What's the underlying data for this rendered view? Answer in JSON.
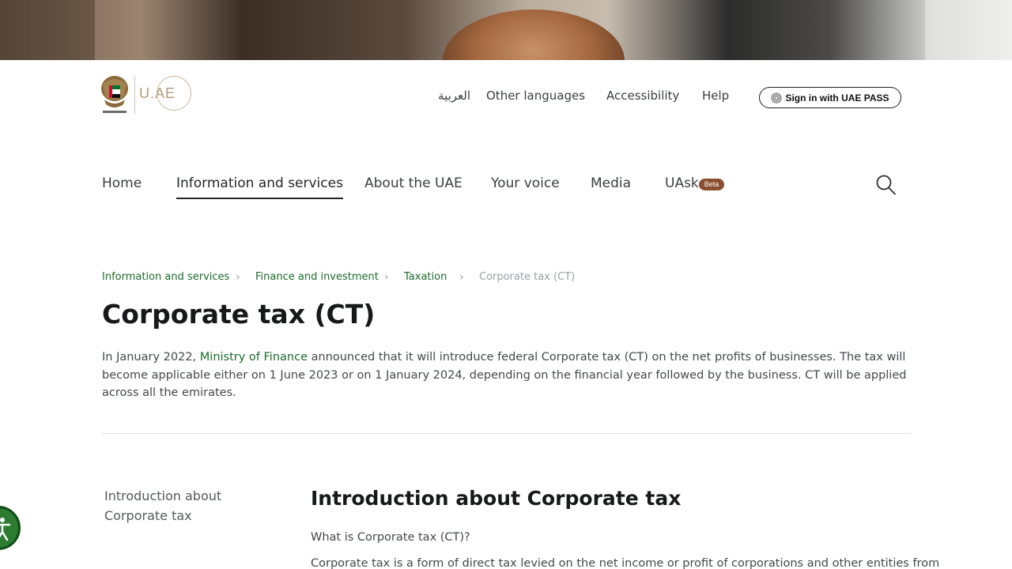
{
  "header": {
    "logo_text": "U.AE",
    "links": {
      "arabic": "العربية",
      "other_languages": "Other languages",
      "accessibility": "Accessibility",
      "help": "Help"
    },
    "sign_in_label": "Sign in with UAE PASS"
  },
  "nav": {
    "items": [
      "Home",
      "Information and services",
      "About the UAE",
      "Your voice",
      "Media",
      "UAsk"
    ],
    "active": "Information and services",
    "beta_label": "Beta"
  },
  "breadcrumb": [
    "Information and services",
    "Finance and investment",
    "Taxation",
    "Corporate tax (CT)"
  ],
  "page": {
    "title": "Corporate tax (CT)",
    "intro_before_link": "In January 2022, ",
    "intro_link": "Ministry of Finance",
    "intro_after_link": " announced that it will introduce federal Corporate tax (CT) on the net profits of businesses. The tax will become applicable either on 1 June 2023 or on 1 January 2024, depending on the financial year followed by the business. CT will be applied across all the emirates."
  },
  "side_nav": {
    "item": "Introduction about Corporate tax"
  },
  "section": {
    "heading": "Introduction about Corporate tax",
    "question": "What is Corporate tax (CT)?",
    "paragraph": "Corporate tax is a form of direct tax levied on the net income or profit of corporations and other entities from"
  },
  "colors": {
    "link_green": "#1b6b2a",
    "beta_badge": "#8a4d2e",
    "accessibility_widget": "#2c7d32"
  },
  "icons": [
    "uae-emblem-icon",
    "fingerprint-icon",
    "search-icon",
    "accessibility-icon",
    "chevron-right-icon"
  ]
}
